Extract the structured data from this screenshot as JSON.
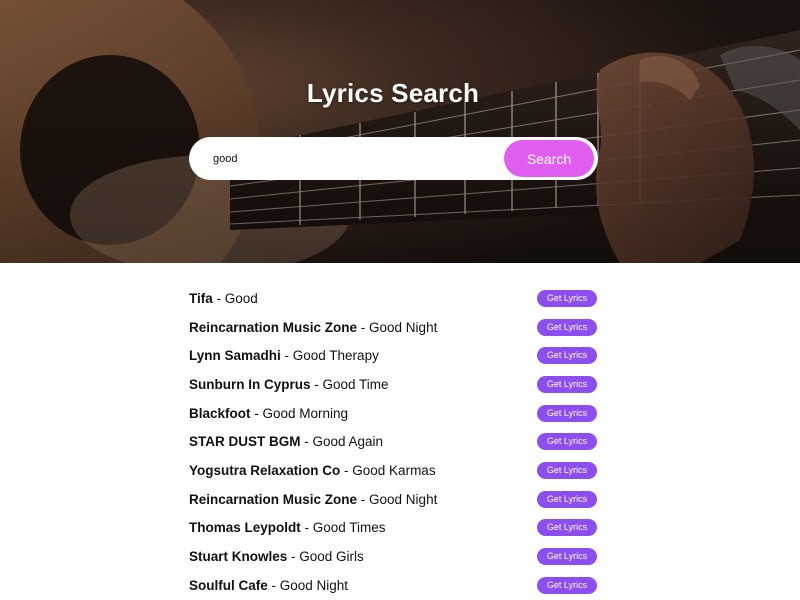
{
  "header": {
    "title": "Lyrics Search"
  },
  "search": {
    "value": "good",
    "button_label": "Search"
  },
  "colors": {
    "search_button": "#e05ff0",
    "lyrics_button": "#8c4ef0"
  },
  "results": [
    {
      "artist": "Tifa",
      "separator": " - ",
      "song": "Good",
      "button_label": "Get Lyrics"
    },
    {
      "artist": "Reincarnation Music Zone",
      "separator": " - ",
      "song": "Good Night",
      "button_label": "Get Lyrics"
    },
    {
      "artist": "Lynn Samadhi",
      "separator": " - ",
      "song": "Good Therapy",
      "button_label": "Get Lyrics"
    },
    {
      "artist": "Sunburn In Cyprus",
      "separator": " - ",
      "song": "Good Time",
      "button_label": "Get Lyrics"
    },
    {
      "artist": "Blackfoot",
      "separator": " - ",
      "song": "Good Morning",
      "button_label": "Get Lyrics"
    },
    {
      "artist": "STAR DUST BGM",
      "separator": " - ",
      "song": "Good Again",
      "button_label": "Get Lyrics"
    },
    {
      "artist": "Yogsutra Relaxation Co",
      "separator": " - ",
      "song": "Good Karmas",
      "button_label": "Get Lyrics"
    },
    {
      "artist": "Reincarnation Music Zone",
      "separator": " - ",
      "song": "Good Night",
      "button_label": "Get Lyrics"
    },
    {
      "artist": "Thomas Leypoldt",
      "separator": " - ",
      "song": "Good Times",
      "button_label": "Get Lyrics"
    },
    {
      "artist": "Stuart Knowles",
      "separator": " - ",
      "song": "Good Girls",
      "button_label": "Get Lyrics"
    },
    {
      "artist": "Soulful Cafe",
      "separator": " - ",
      "song": "Good Night",
      "button_label": "Get Lyrics"
    }
  ]
}
